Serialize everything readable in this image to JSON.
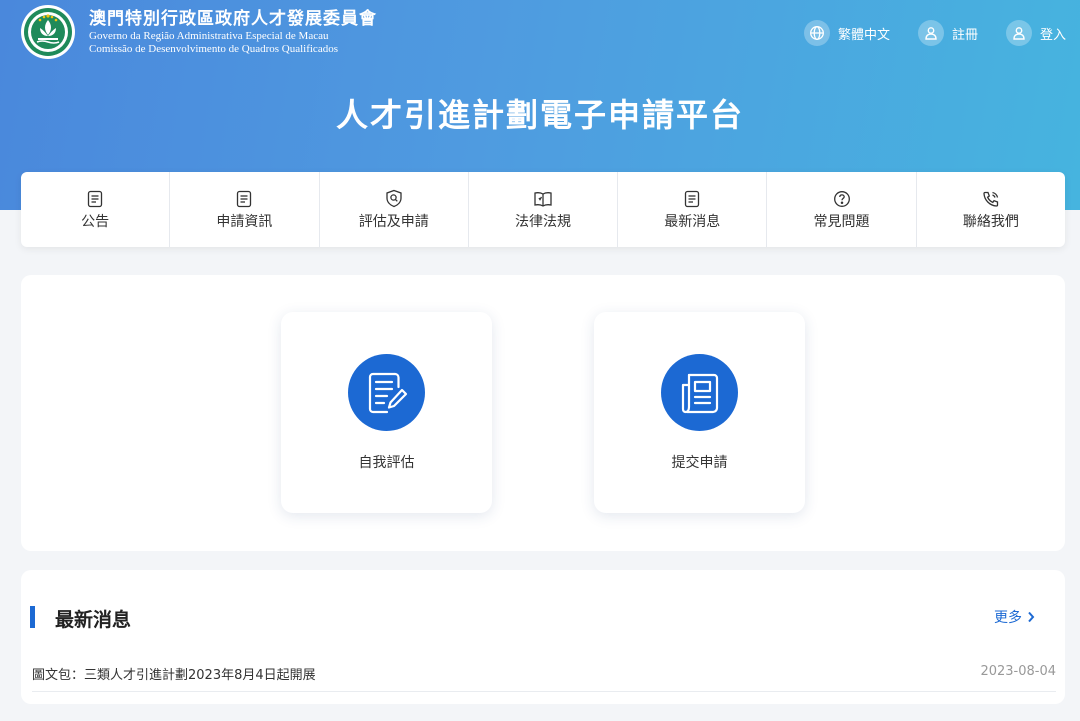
{
  "header": {
    "org_zh": "澳門特別行政區政府人才發展委員會",
    "org_pt_line1": "Governo da Região Administrativa Especial de Macau",
    "org_pt_line2": "Comissão de Desenvolvimento de Quadros Qualificados",
    "logo_icon": "macau-emblem-icon",
    "actions": [
      {
        "label": "繁體中文",
        "icon": "globe-icon"
      },
      {
        "label": "註冊",
        "icon": "user-icon"
      },
      {
        "label": "登入",
        "icon": "user-icon"
      }
    ],
    "platform_title": "人才引進計劃電子申請平台"
  },
  "nav": [
    {
      "label": "公告",
      "icon": "document-icon"
    },
    {
      "label": "申請資訊",
      "icon": "document-icon"
    },
    {
      "label": "評估及申請",
      "icon": "shield-search-icon"
    },
    {
      "label": "法律法規",
      "icon": "book-icon"
    },
    {
      "label": "最新消息",
      "icon": "document-icon"
    },
    {
      "label": "常見問題",
      "icon": "question-icon"
    },
    {
      "label": "聯絡我們",
      "icon": "phone-icon"
    }
  ],
  "services": [
    {
      "label": "自我評估",
      "icon": "edit-document-icon"
    },
    {
      "label": "提交申請",
      "icon": "newspaper-icon"
    }
  ],
  "news": {
    "title": "最新消息",
    "more_label": "更多",
    "items": [
      {
        "text": "圖文包：三類人才引進計劃2023年8月4日起開展",
        "date": "2023-08-04"
      }
    ]
  },
  "colors": {
    "primary": "#1c69d3",
    "hero_start": "#4a88dc",
    "hero_end": "#46b4df",
    "page_bg": "#f3f5f8"
  }
}
